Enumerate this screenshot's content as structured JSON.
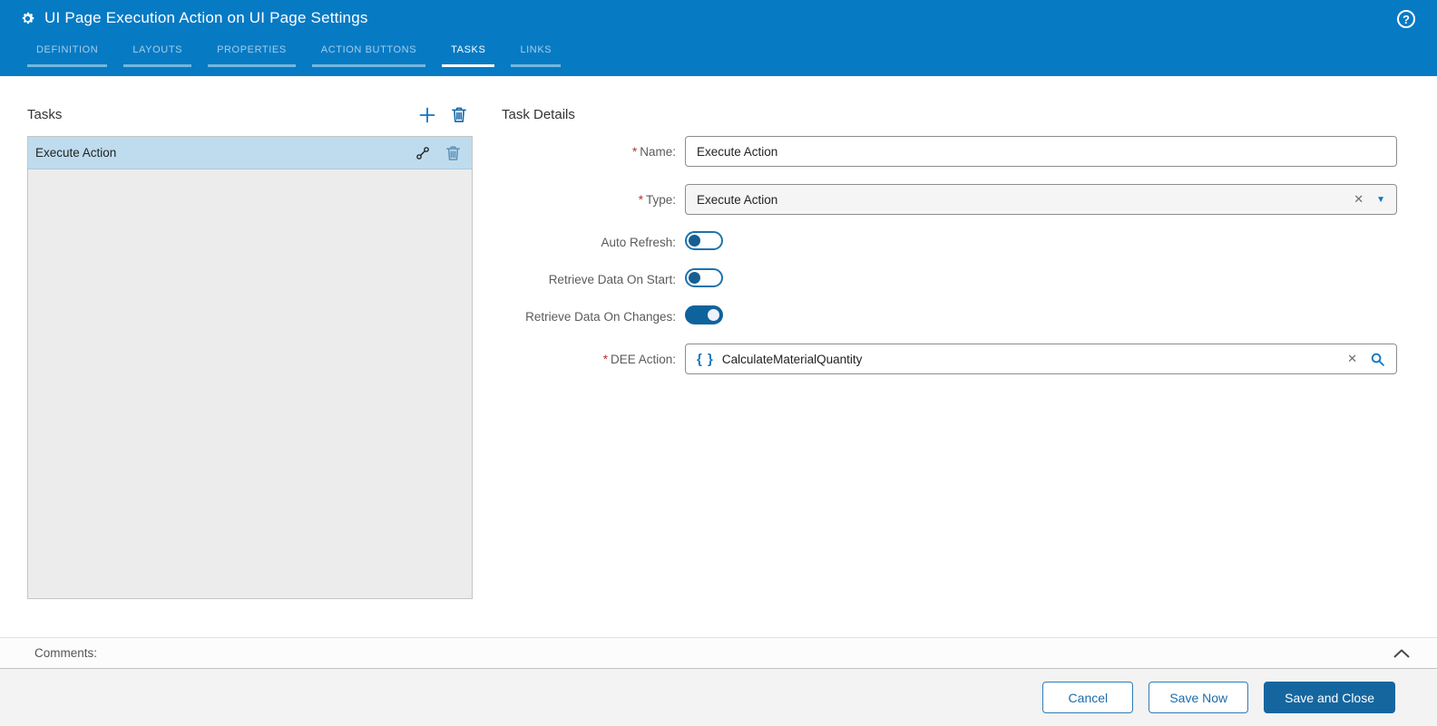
{
  "ui": {
    "required_marker": "*"
  },
  "icons": {
    "help": "?",
    "clear": "✕",
    "caret_down": "▼",
    "braces": "{ }"
  },
  "colors": {
    "header_blue": "#077ac4",
    "accent_blue": "#1076c0",
    "primary_button_blue": "#15669f",
    "toggle_on_blue": "#0f639c",
    "selected_item_bg": "#bedcee",
    "required_red": "#b5342a"
  },
  "header": {
    "title": "UI Page Execution Action on UI Page Settings",
    "tabs": [
      {
        "label": "DEFINITION",
        "active": false
      },
      {
        "label": "LAYOUTS",
        "active": false
      },
      {
        "label": "PROPERTIES",
        "active": false
      },
      {
        "label": "ACTION BUTTONS",
        "active": false
      },
      {
        "label": "TASKS",
        "active": true
      },
      {
        "label": "LINKS",
        "active": false
      }
    ]
  },
  "tasks_panel": {
    "title": "Tasks",
    "items": [
      {
        "label": "Execute Action",
        "selected": true
      }
    ]
  },
  "details_panel": {
    "title": "Task Details",
    "fields": {
      "name": {
        "label": "Name:",
        "required": true,
        "value": "Execute Action"
      },
      "type": {
        "label": "Type:",
        "required": true,
        "value": "Execute Action"
      },
      "auto_refresh": {
        "label": "Auto Refresh:",
        "value": false
      },
      "retrieve_data_on_start": {
        "label": "Retrieve Data On Start:",
        "value": false
      },
      "retrieve_data_on_changes": {
        "label": "Retrieve Data On Changes:",
        "value": true
      },
      "dee_action": {
        "label": "DEE Action:",
        "required": true,
        "value": "CalculateMaterialQuantity"
      }
    }
  },
  "comments": {
    "label": "Comments:"
  },
  "footer": {
    "buttons": [
      {
        "label": "Cancel",
        "primary": false
      },
      {
        "label": "Save Now",
        "primary": false
      },
      {
        "label": "Save and Close",
        "primary": true
      }
    ]
  }
}
